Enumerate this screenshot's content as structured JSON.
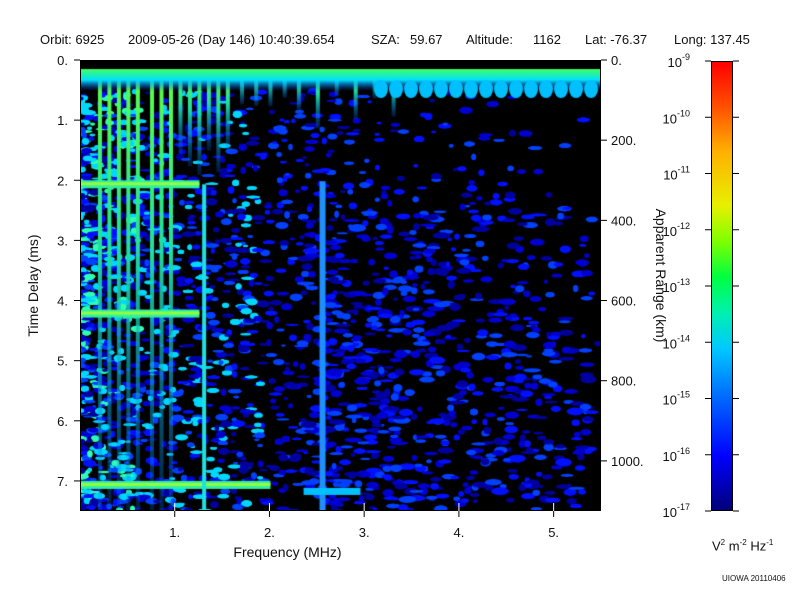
{
  "header": {
    "orbit": "Orbit: 6925",
    "date": "2009-05-26 (Day 146) 10:40:39.654",
    "sza_label": "SZA:",
    "sza_value": "59.67",
    "altitude_label": "Altitude:",
    "altitude_value": "1162",
    "lat": "Lat: -76.37",
    "long": "Long: 137.45"
  },
  "credit": "UIOWA 20110406",
  "chart_data": {
    "type": "heatmap",
    "xlabel": "Frequency (MHz)",
    "ylabel": "Time Delay (ms)",
    "y2label": "Apparent Range (km)",
    "xlim": [
      0.0,
      5.5
    ],
    "ylim": [
      0.0,
      7.5
    ],
    "y_inverted": true,
    "x_ticks": [
      1,
      2,
      3,
      4,
      5
    ],
    "x_tick_labels": [
      "1.",
      "2.",
      "3.",
      "4.",
      "5."
    ],
    "y_ticks": [
      0,
      1,
      2,
      3,
      4,
      5,
      6,
      7
    ],
    "y_tick_labels": [
      "0.",
      "1.",
      "2.",
      "3.",
      "4.",
      "5.",
      "6.",
      "7."
    ],
    "y2_ticks_km": [
      0,
      200,
      400,
      600,
      800,
      1000
    ],
    "y2_tick_labels": [
      "0.",
      "200.",
      "400.",
      "600.",
      "800.",
      "1000."
    ],
    "y2_km_per_ms": 150,
    "colorbar": {
      "scale": "log",
      "range": [
        1e-17,
        1e-09
      ],
      "tick_exponents": [
        -9,
        -10,
        -11,
        -12,
        -13,
        -14,
        -15,
        -16,
        -17
      ],
      "tick_base": "10",
      "unit_parts": [
        "V",
        "2",
        " m",
        "-2",
        " Hz",
        "-1"
      ]
    },
    "features": {
      "surface_echo_delay_ms": 0.3,
      "vertical_lines_mhz": [
        0.2,
        0.3,
        0.4,
        0.5,
        0.6,
        0.75,
        0.85,
        0.95,
        1.05,
        1.15,
        1.25,
        1.35,
        1.45,
        1.55,
        1.7,
        1.85,
        2.0,
        2.15,
        2.3,
        2.5,
        2.7,
        2.9,
        3.1,
        3.3
      ],
      "horizontal_bands_ms": [
        2.05,
        4.2,
        7.05
      ]
    }
  }
}
